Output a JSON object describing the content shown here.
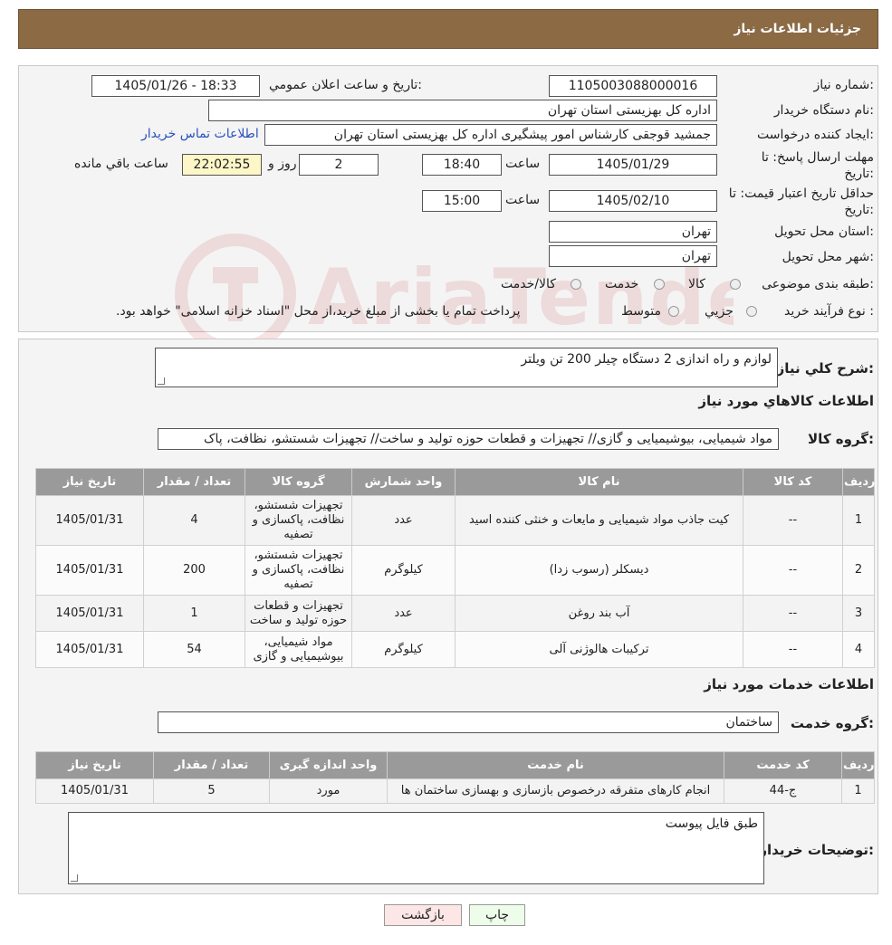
{
  "header": {
    "title": "جزئیات اطلاعات نیاز"
  },
  "form": {
    "need_number_label": "شماره نیاز:",
    "need_number": "1105003088000016",
    "announce_label": "تاریخ و ساعت اعلان عمومي:",
    "announce_value": "1405/01/26 - 18:33",
    "buyer_org_label": "نام دستگاه خریدار:",
    "buyer_org": "اداره کل بهزیستی استان تهران",
    "creator_label": "ایجاد کننده درخواست:",
    "creator": "جمشید قوجقی کارشناس امور پیشگیری اداره کل بهزیستی استان تهران",
    "contact_link": "اطلاعات تماس خریدار",
    "deadline_label_1": "مهلت ارسال پاسخ: تا",
    "deadline_label_2": "تاریخ:",
    "deadline_date": "1405/01/29",
    "time_label": "ساعت",
    "deadline_time": "18:40",
    "days_value": "2",
    "days_label": "روز و",
    "remaining_time": "22:02:55",
    "remaining_label": "ساعت باقي مانده",
    "validity_label_1": "حداقل تاریخ اعتبار قیمت: تا",
    "validity_label_2": "تاریخ:",
    "validity_date": "1405/02/10",
    "validity_time": "15:00",
    "province_label": "استان محل تحویل:",
    "province": "تهران",
    "city_label": "شهر محل تحویل:",
    "city": "تهران",
    "category_label": "طبقه بندی موضوعی:",
    "category_options": [
      "کالا",
      "خدمت",
      "کالا/خدمت"
    ],
    "process_label": "نوع فرآیند خرید :",
    "process_options": [
      "جزیي",
      "متوسط"
    ],
    "process_note": "پرداخت تمام یا بخشی از مبلغ خرید،از محل \"اسناد خزانه اسلامی\" خواهد بود."
  },
  "watermark": "AriaTender.neT",
  "description": {
    "label": "شرح کلي نیاز:",
    "value": "لوازم و راه اندازی 2 دستگاه چیلر 200 تن ویلتر"
  },
  "goods": {
    "title": "اطلاعات کالاهاي مورد نیاز",
    "group_label": "گروه کالا:",
    "group_value": "مواد شیمیایی، بیوشیمیایی و  گازی// تجهیزات و قطعات حوزه تولید و ساخت// تجهیزات شستشو، نظافت، پاک",
    "headers": [
      "ردیف",
      "کد کالا",
      "نام کالا",
      "واحد شمارش",
      "گروه کالا",
      "تعداد / مقدار",
      "تاریخ نیاز"
    ],
    "rows": [
      [
        "1",
        "--",
        "کیت جاذب مواد شیمیایی و مایعات و خنثی کننده اسید",
        "عدد",
        "تجهیزات شستشو، نظافت، پاکسازی و تصفیه",
        "4",
        "1405/01/31"
      ],
      [
        "2",
        "--",
        "دیسکلر (رسوب زدا)",
        "کیلوگرم",
        "تجهیزات شستشو، نظافت، پاکسازی و تصفیه",
        "200",
        "1405/01/31"
      ],
      [
        "3",
        "--",
        "آب بند روغن",
        "عدد",
        "تجهیزات و قطعات حوزه تولید و ساخت",
        "1",
        "1405/01/31"
      ],
      [
        "4",
        "--",
        "ترکیبات هالوژنی آلی",
        "کیلوگرم",
        "مواد شیمیایی، بیوشیمیایی و گازی",
        "54",
        "1405/01/31"
      ]
    ]
  },
  "services": {
    "title": "اطلاعات خدمات مورد نیاز",
    "group_label": "گروه خدمت:",
    "group_value": "ساختمان",
    "headers": [
      "ردیف",
      "کد خدمت",
      "نام خدمت",
      "واحد اندازه گیری",
      "تعداد / مقدار",
      "تاریخ نیاز"
    ],
    "rows": [
      [
        "1",
        "ج-44",
        "انجام کارهای متفرقه درخصوص بازسازی و بهسازی ساختمان ها",
        "مورد",
        "5",
        "1405/01/31"
      ]
    ]
  },
  "buyer_notes": {
    "label": "توضیحات خریدار:",
    "value": "طبق فایل پیوست"
  },
  "buttons": {
    "print": "چاپ",
    "back": "بازگشت"
  }
}
